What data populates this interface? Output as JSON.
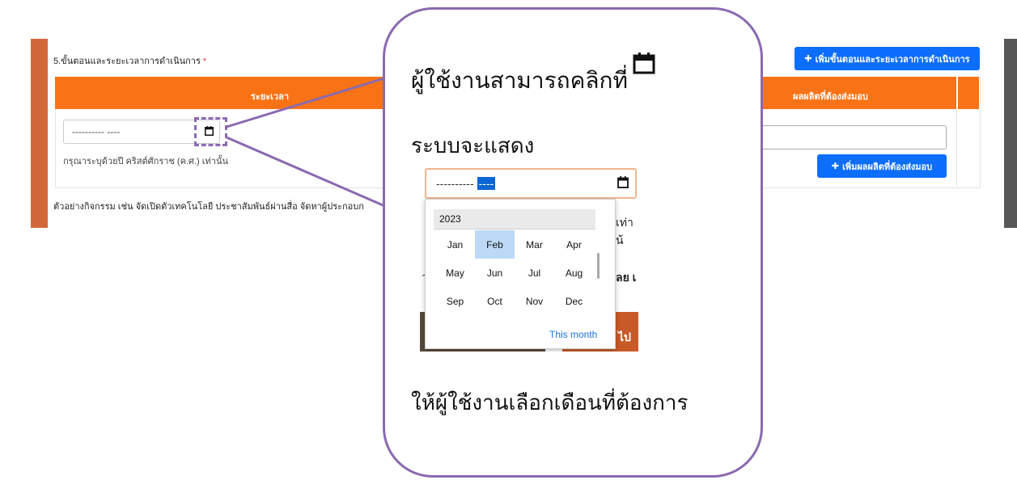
{
  "form": {
    "section_title": "5.ขั้นตอนและระยะเวลาการดำเนินการ",
    "required_mark": "*",
    "add_step_button": "เพิ่มขั้นตอนและระยะเวลาการดำเนินการ",
    "plus_glyph": "✚",
    "table_headers": {
      "period": "ระยะเวลา",
      "deliverable": "ผลผลิตที่ต้องส่งมอบ"
    },
    "date_input_value": "---------- ----",
    "date_hint": "กรุณาระบุด้วยปี คริสต์ศักราช (ค.ศ.) เท่านั้น",
    "add_output_button": "เพิ่มผลผลิตที่ต้องส่งมอบ",
    "example_text": "ตัวอย่างกิจกรรม เช่น จัดเปิดตัวเทคโนโลยี ประชาสัมพันธ์ผ่านสื่อ จัดหาผู้ประกอบก"
  },
  "callout": {
    "line1": "ผู้ใช้งานสามารถคลิกที่",
    "line2": "ระบบจะแสดง",
    "line3": "ให้ผู้ใช้งานเลือกเดือนที่ต้องการ"
  },
  "picker_shot": {
    "input_dashes": "----------",
    "input_selected": "----",
    "behind_text_1": "เท่าน้",
    "behind_text_2": "ลย เ",
    "behind_text_3": "ไป",
    "behind_text_4": "ว",
    "year": "2023",
    "months": [
      "Jan",
      "Feb",
      "Mar",
      "Apr",
      "May",
      "Jun",
      "Jul",
      "Aug",
      "Sep",
      "Oct",
      "Nov",
      "Dec"
    ],
    "selected_month": "Feb",
    "this_month_label": "This month"
  },
  "colors": {
    "table_header": "#f97316",
    "primary_button": "#0d6efd",
    "callout_border": "#8a6ab0",
    "left_bar": "#d2683a",
    "right_bar": "#575757"
  }
}
